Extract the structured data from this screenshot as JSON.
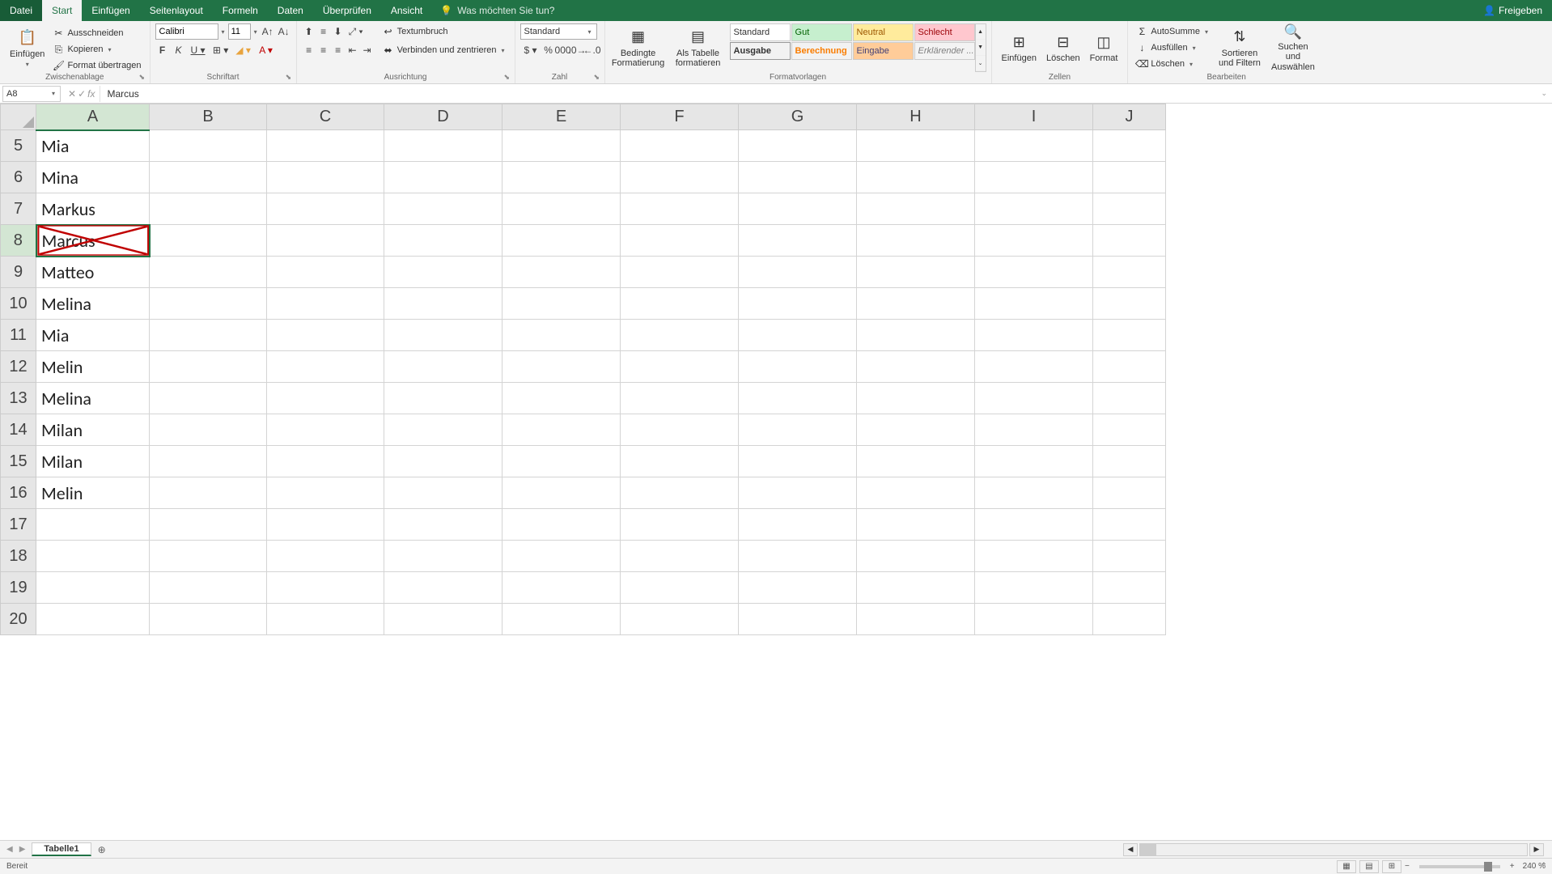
{
  "titleTabs": {
    "file": "Datei",
    "items": [
      "Start",
      "Einfügen",
      "Seitenlayout",
      "Formeln",
      "Daten",
      "Überprüfen",
      "Ansicht"
    ],
    "activeIndex": 0,
    "searchPlaceholder": "Was möchten Sie tun?",
    "share": "Freigeben"
  },
  "ribbon": {
    "clipboard": {
      "paste": "Einfügen",
      "cut": "Ausschneiden",
      "copy": "Kopieren",
      "formatPainter": "Format übertragen",
      "label": "Zwischenablage"
    },
    "font": {
      "name": "Calibri",
      "size": "11",
      "label": "Schriftart"
    },
    "alignment": {
      "wrap": "Textumbruch",
      "merge": "Verbinden und zentrieren",
      "label": "Ausrichtung"
    },
    "number": {
      "format": "Standard",
      "label": "Zahl"
    },
    "styles": {
      "conditional": "Bedingte Formatierung",
      "asTable": "Als Tabelle formatieren",
      "gallery": [
        "Standard",
        "Gut",
        "Neutral",
        "Schlecht",
        "Ausgabe",
        "Berechnung",
        "Eingabe",
        "Erklärender ..."
      ],
      "label": "Formatvorlagen"
    },
    "cells": {
      "insert": "Einfügen",
      "delete": "Löschen",
      "format": "Format",
      "label": "Zellen"
    },
    "editing": {
      "autosum": "AutoSumme",
      "fill": "Ausfüllen",
      "clear": "Löschen",
      "sort": "Sortieren und Filtern",
      "find": "Suchen und Auswählen",
      "label": "Bearbeiten"
    }
  },
  "formulaBar": {
    "nameBox": "A8",
    "value": "Marcus"
  },
  "columns": [
    "A",
    "B",
    "C",
    "D",
    "E",
    "F",
    "G",
    "H",
    "I",
    "J"
  ],
  "rows": [
    {
      "num": "5",
      "A": "Mia"
    },
    {
      "num": "6",
      "A": "Mina"
    },
    {
      "num": "7",
      "A": "Markus"
    },
    {
      "num": "8",
      "A": "Marcus",
      "selected": true,
      "crossed": true
    },
    {
      "num": "9",
      "A": "Matteo"
    },
    {
      "num": "10",
      "A": "Melina"
    },
    {
      "num": "11",
      "A": "Mia"
    },
    {
      "num": "12",
      "A": "Melin"
    },
    {
      "num": "13",
      "A": "Melina"
    },
    {
      "num": "14",
      "A": "Milan"
    },
    {
      "num": "15",
      "A": "Milan"
    },
    {
      "num": "16",
      "A": "Melin"
    },
    {
      "num": "17",
      "A": ""
    },
    {
      "num": "18",
      "A": ""
    },
    {
      "num": "19",
      "A": ""
    },
    {
      "num": "20",
      "A": ""
    }
  ],
  "sheet": {
    "name": "Tabelle1"
  },
  "status": {
    "ready": "Bereit",
    "zoom": "240 %"
  }
}
